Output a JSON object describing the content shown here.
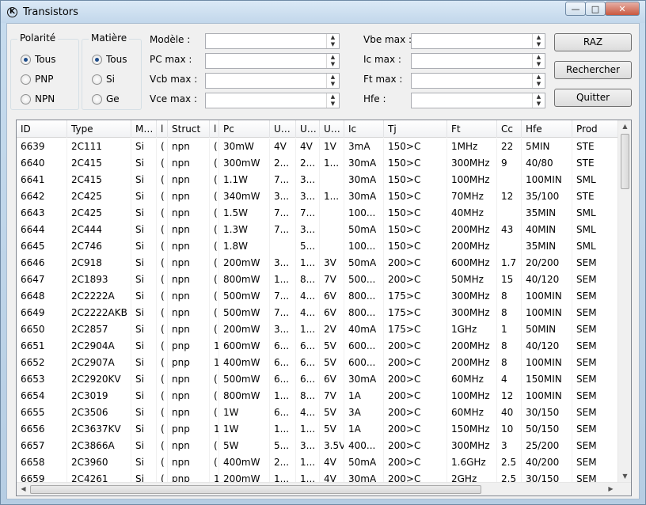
{
  "window": {
    "title": "Transistors",
    "icon": "app-logo-icon"
  },
  "polarite": {
    "legend": "Polarité",
    "options": [
      "Tous",
      "PNP",
      "NPN"
    ],
    "selected": "Tous"
  },
  "matiere": {
    "legend": "Matière",
    "options": [
      "Tous",
      "Si",
      "Ge"
    ],
    "selected": "Tous"
  },
  "filters": {
    "modele": {
      "label": "Modèle :",
      "value": ""
    },
    "pc_max": {
      "label": "PC max :",
      "value": ""
    },
    "vcb_max": {
      "label": "Vcb max :",
      "value": ""
    },
    "vce_max": {
      "label": "Vce max :",
      "value": ""
    },
    "vbe_max": {
      "label": "Vbe max :",
      "value": ""
    },
    "ic_max": {
      "label": "Ic max :",
      "value": ""
    },
    "ft_max": {
      "label": "Ft max :",
      "value": ""
    },
    "hfe": {
      "label": "Hfe :",
      "value": ""
    }
  },
  "buttons": {
    "raz": "RAZ",
    "rechercher": "Rechercher",
    "quitter": "Quitter"
  },
  "table": {
    "columns": [
      "ID",
      "Type",
      "M…",
      "l",
      "Struct",
      "l",
      "Pc",
      "U…",
      "U…",
      "U…",
      "Ic",
      "Tj",
      "Ft",
      "Cc",
      "Hfe",
      "Prod"
    ],
    "rows": [
      [
        "6639",
        "2C111",
        "Si",
        "(",
        "npn",
        "(",
        "30mW",
        "4V",
        "4V",
        "1V",
        "3mA",
        "150>C",
        "1MHz",
        "22",
        "5MIN",
        "STE"
      ],
      [
        "6640",
        "2C415",
        "Si",
        "(",
        "npn",
        "(",
        "300mW",
        "2...",
        "2...",
        "1...",
        "30mA",
        "150>C",
        "300MHz",
        "9",
        "40/80",
        "STE"
      ],
      [
        "6641",
        "2C415",
        "Si",
        "(",
        "npn",
        "(",
        "1.1W",
        "7...",
        "3...",
        "",
        "30mA",
        "150>C",
        "100MHz",
        "",
        "100MIN",
        "SML"
      ],
      [
        "6642",
        "2C425",
        "Si",
        "(",
        "npn",
        "(",
        "340mW",
        "3...",
        "3...",
        "1...",
        "30mA",
        "150>C",
        "70MHz",
        "12",
        "35/100",
        "STE"
      ],
      [
        "6643",
        "2C425",
        "Si",
        "(",
        "npn",
        "(",
        "1.5W",
        "7...",
        "7...",
        "",
        "100...",
        "150>C",
        "40MHz",
        "",
        "35MIN",
        "SML"
      ],
      [
        "6644",
        "2C444",
        "Si",
        "(",
        "npn",
        "(",
        "1.3W",
        "7...",
        "3...",
        "",
        "50mA",
        "150>C",
        "200MHz",
        "43",
        "40MIN",
        "SML"
      ],
      [
        "6645",
        "2C746",
        "Si",
        "(",
        "npn",
        "(",
        "1.8W",
        "",
        "5...",
        "",
        "100...",
        "150>C",
        "200MHz",
        "",
        "35MIN",
        "SML"
      ],
      [
        "6646",
        "2C918",
        "Si",
        "(",
        "npn",
        "(",
        "200mW",
        "3...",
        "1...",
        "3V",
        "50mA",
        "200>C",
        "600MHz",
        "1.7",
        "20/200",
        "SEM"
      ],
      [
        "6647",
        "2C1893",
        "Si",
        "(",
        "npn",
        "(",
        "800mW",
        "1...",
        "8...",
        "7V",
        "500...",
        "200>C",
        "50MHz",
        "15",
        "40/120",
        "SEM"
      ],
      [
        "6648",
        "2C2222A",
        "Si",
        "(",
        "npn",
        "(",
        "500mW",
        "7...",
        "4...",
        "6V",
        "800...",
        "175>C",
        "300MHz",
        "8",
        "100MIN",
        "SEM"
      ],
      [
        "6649",
        "2C2222AKB",
        "Si",
        "(",
        "npn",
        "(",
        "500mW",
        "7...",
        "4...",
        "6V",
        "800...",
        "175>C",
        "300MHz",
        "8",
        "100MIN",
        "SEM"
      ],
      [
        "6650",
        "2C2857",
        "Si",
        "(",
        "npn",
        "(",
        "200mW",
        "3...",
        "1...",
        "2V",
        "40mA",
        "175>C",
        "1GHz",
        "1",
        "50MIN",
        "SEM"
      ],
      [
        "6651",
        "2C2904A",
        "Si",
        "(",
        "pnp",
        "1",
        "600mW",
        "6...",
        "6...",
        "5V",
        "600...",
        "200>C",
        "200MHz",
        "8",
        "40/120",
        "SEM"
      ],
      [
        "6652",
        "2C2907A",
        "Si",
        "(",
        "pnp",
        "1",
        "400mW",
        "6...",
        "6...",
        "5V",
        "600...",
        "200>C",
        "200MHz",
        "8",
        "100MIN",
        "SEM"
      ],
      [
        "6653",
        "2C2920KV",
        "Si",
        "(",
        "npn",
        "(",
        "500mW",
        "6...",
        "6...",
        "6V",
        "30mA",
        "200>C",
        "60MHz",
        "4",
        "150MIN",
        "SEM"
      ],
      [
        "6654",
        "2C3019",
        "Si",
        "(",
        "npn",
        "(",
        "800mW",
        "1...",
        "8...",
        "7V",
        "1A",
        "200>C",
        "100MHz",
        "12",
        "100MIN",
        "SEM"
      ],
      [
        "6655",
        "2C3506",
        "Si",
        "(",
        "npn",
        "(",
        "1W",
        "6...",
        "4...",
        "5V",
        "3A",
        "200>C",
        "60MHz",
        "40",
        "30/150",
        "SEM"
      ],
      [
        "6656",
        "2C3637KV",
        "Si",
        "(",
        "pnp",
        "1",
        "1W",
        "1...",
        "1...",
        "5V",
        "1A",
        "200>C",
        "150MHz",
        "10",
        "50/150",
        "SEM"
      ],
      [
        "6657",
        "2C3866A",
        "Si",
        "(",
        "npn",
        "(",
        "5W",
        "5...",
        "3...",
        "3.5V",
        "400...",
        "200>C",
        "300MHz",
        "3",
        "25/200",
        "SEM"
      ],
      [
        "6658",
        "2C3960",
        "Si",
        "(",
        "npn",
        "(",
        "400mW",
        "2...",
        "1...",
        "4V",
        "50mA",
        "200>C",
        "1.6GHz",
        "2.5",
        "40/200",
        "SEM"
      ],
      [
        "6659",
        "2C4261",
        "Si",
        "(",
        "pnp",
        "1",
        "200mW",
        "1...",
        "1...",
        "4V",
        "30mA",
        "200>C",
        "2GHz",
        "2.5",
        "30/150",
        "SEM"
      ]
    ]
  }
}
